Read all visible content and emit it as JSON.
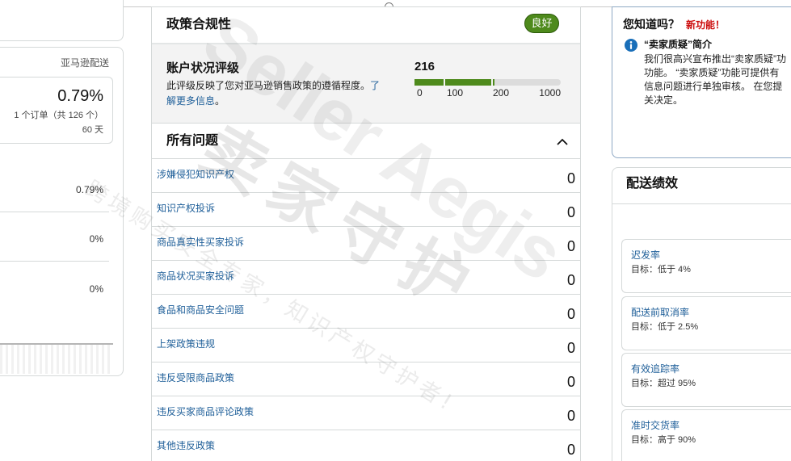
{
  "colors": {
    "link": "#1f5f99",
    "text": "#111111",
    "good_badge": "#4e8a1c",
    "bar_fill": "#4e8a1c",
    "bar_empty": "#dcdcdc",
    "new_feature": "#cc0c0c",
    "info_icon": "#1a6fb9"
  },
  "customer_service": {
    "column_header": "亚马逊配送",
    "odr": {
      "value": "0.79%",
      "orders": "1 个订单（共 126 个）",
      "period": "60 天"
    },
    "metrics": [
      "0.79%",
      "0%",
      "0%"
    ]
  },
  "policy_compliance": {
    "title": "政策合规性",
    "status_badge": "良好",
    "account_health_rating": {
      "title": "账户状况评级",
      "description": "此评级反映了您对亚马逊销售政策的遵循程度。",
      "learn_more": "了解更多信息",
      "trailing": "。",
      "score": 216,
      "scale": [
        0,
        100,
        200,
        1000
      ]
    },
    "issues_header": "所有问题",
    "issues": [
      {
        "label": "涉嫌侵犯知识产权",
        "count": "0"
      },
      {
        "label": "知识产权投诉",
        "count": "0"
      },
      {
        "label": "商品真实性买家投诉",
        "count": "0"
      },
      {
        "label": "商品状况买家投诉",
        "count": "0"
      },
      {
        "label": "食品和商品安全问题",
        "count": "0"
      },
      {
        "label": "上架政策违规",
        "count": "0"
      },
      {
        "label": "违反受限商品政策",
        "count": "0"
      },
      {
        "label": "违反买家商品评论政策",
        "count": "0"
      },
      {
        "label": "其他违反政策",
        "count": "0"
      }
    ]
  },
  "did_you_know": {
    "title": "您知道吗？",
    "new_tag": "新功能！",
    "icon": "info-icon",
    "heading": "“卖家质疑”简介",
    "lines": [
      "我们很高兴宣布推出“卖家质疑”功",
      "功能。 “卖家质疑”功能可提供有",
      "信息问题进行单独审核。 在您提",
      "关决定。"
    ]
  },
  "shipping_performance": {
    "title": "配送绩效",
    "metrics": [
      {
        "name": "迟发率",
        "target": "目标：低于 4%"
      },
      {
        "name": "配送前取消率",
        "target": "目标：低于 2.5%"
      },
      {
        "name": "有效追踪率",
        "target": "目标：超过 95%"
      },
      {
        "name": "准时交货率",
        "target": "目标：高于 90%"
      }
    ]
  },
  "watermark": {
    "brand": "Seller Aegis",
    "brand_cn": "卖家守护",
    "slogan": "跨境购买安全专家，知识产权守护者!"
  }
}
